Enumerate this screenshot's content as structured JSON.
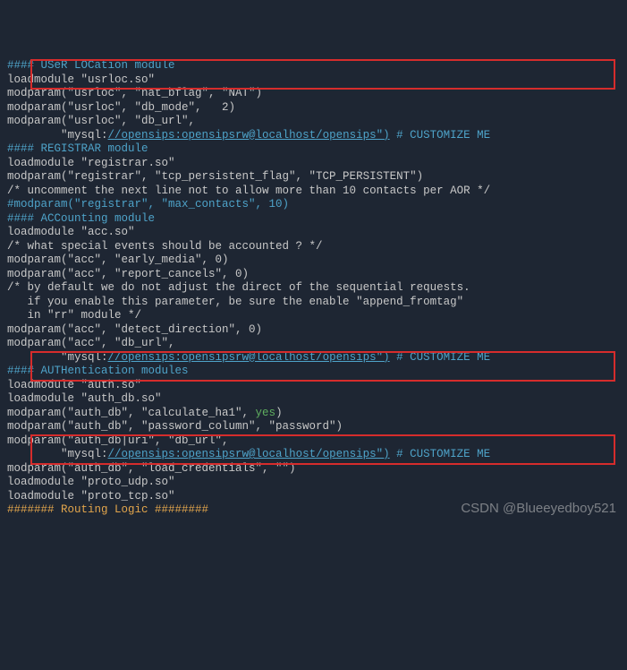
{
  "lines": [
    {
      "cls": "hl",
      "text": "#### USeR LOCation module"
    },
    {
      "cls": "",
      "text": "loadmodule \"usrloc.so\""
    },
    {
      "cls": "",
      "text": "modparam(\"usrloc\", \"nat_bflag\", \"NAT\")"
    },
    {
      "cls": "",
      "text": "modparam(\"usrloc\", \"db_mode\",   2)"
    },
    {
      "cls": "",
      "text": "modparam(\"usrloc\", \"db_url\","
    },
    {
      "cls": "url",
      "pre": "        \"mysql:",
      "url": "//opensips:opensipsrw@localhost/opensips\")",
      "post": " # CUSTOMIZE ME"
    },
    {
      "cls": "",
      "text": ""
    },
    {
      "cls": "",
      "text": ""
    },
    {
      "cls": "hl",
      "text": "#### REGISTRAR module"
    },
    {
      "cls": "",
      "text": "loadmodule \"registrar.so\""
    },
    {
      "cls": "",
      "text": "modparam(\"registrar\", \"tcp_persistent_flag\", \"TCP_PERSISTENT\")"
    },
    {
      "cls": "",
      "text": "/* uncomment the next line not to allow more than 10 contacts per AOR */"
    },
    {
      "cls": "hl",
      "text": "#modparam(\"registrar\", \"max_contacts\", 10)"
    },
    {
      "cls": "",
      "text": ""
    },
    {
      "cls": "hl",
      "text": "#### ACCounting module"
    },
    {
      "cls": "",
      "text": "loadmodule \"acc.so\""
    },
    {
      "cls": "",
      "text": "/* what special events should be accounted ? */"
    },
    {
      "cls": "",
      "text": "modparam(\"acc\", \"early_media\", 0)"
    },
    {
      "cls": "",
      "text": "modparam(\"acc\", \"report_cancels\", 0)"
    },
    {
      "cls": "",
      "text": "/* by default we do not adjust the direct of the sequential requests."
    },
    {
      "cls": "",
      "text": "   if you enable this parameter, be sure the enable \"append_fromtag\""
    },
    {
      "cls": "",
      "text": "   in \"rr\" module */"
    },
    {
      "cls": "",
      "text": "modparam(\"acc\", \"detect_direction\", 0)"
    },
    {
      "cls": "",
      "text": "modparam(\"acc\", \"db_url\","
    },
    {
      "cls": "url",
      "pre": "        \"mysql:",
      "url": "//opensips:opensipsrw@localhost/opensips\")",
      "post": " # CUSTOMIZE ME"
    },
    {
      "cls": "",
      "text": ""
    },
    {
      "cls": "hl",
      "text": "#### AUTHentication modules"
    },
    {
      "cls": "",
      "text": "loadmodule \"auth.so\""
    },
    {
      "cls": "",
      "text": "loadmodule \"auth_db.so\""
    },
    {
      "cls": "yes",
      "pre": "modparam(\"auth_db\", \"calculate_ha1\", ",
      "url": "yes",
      "post": ")"
    },
    {
      "cls": "",
      "text": "modparam(\"auth_db\", \"password_column\", \"password\")"
    },
    {
      "cls": "",
      "text": "modparam(\"auth_db|uri\", \"db_url\","
    },
    {
      "cls": "url",
      "pre": "        \"mysql:",
      "url": "//opensips:opensipsrw@localhost/opensips\")",
      "post": " # CUSTOMIZE ME"
    },
    {
      "cls": "",
      "text": "modparam(\"auth_db\", \"load_credentials\", \"\")"
    },
    {
      "cls": "",
      "text": ""
    },
    {
      "cls": "",
      "text": "loadmodule \"proto_udp.so\""
    },
    {
      "cls": "",
      "text": "loadmodule \"proto_tcp.so\""
    },
    {
      "cls": "kw",
      "text": "####### Routing Logic ########"
    }
  ],
  "watermark": "CSDN @Blueeyedboy521"
}
